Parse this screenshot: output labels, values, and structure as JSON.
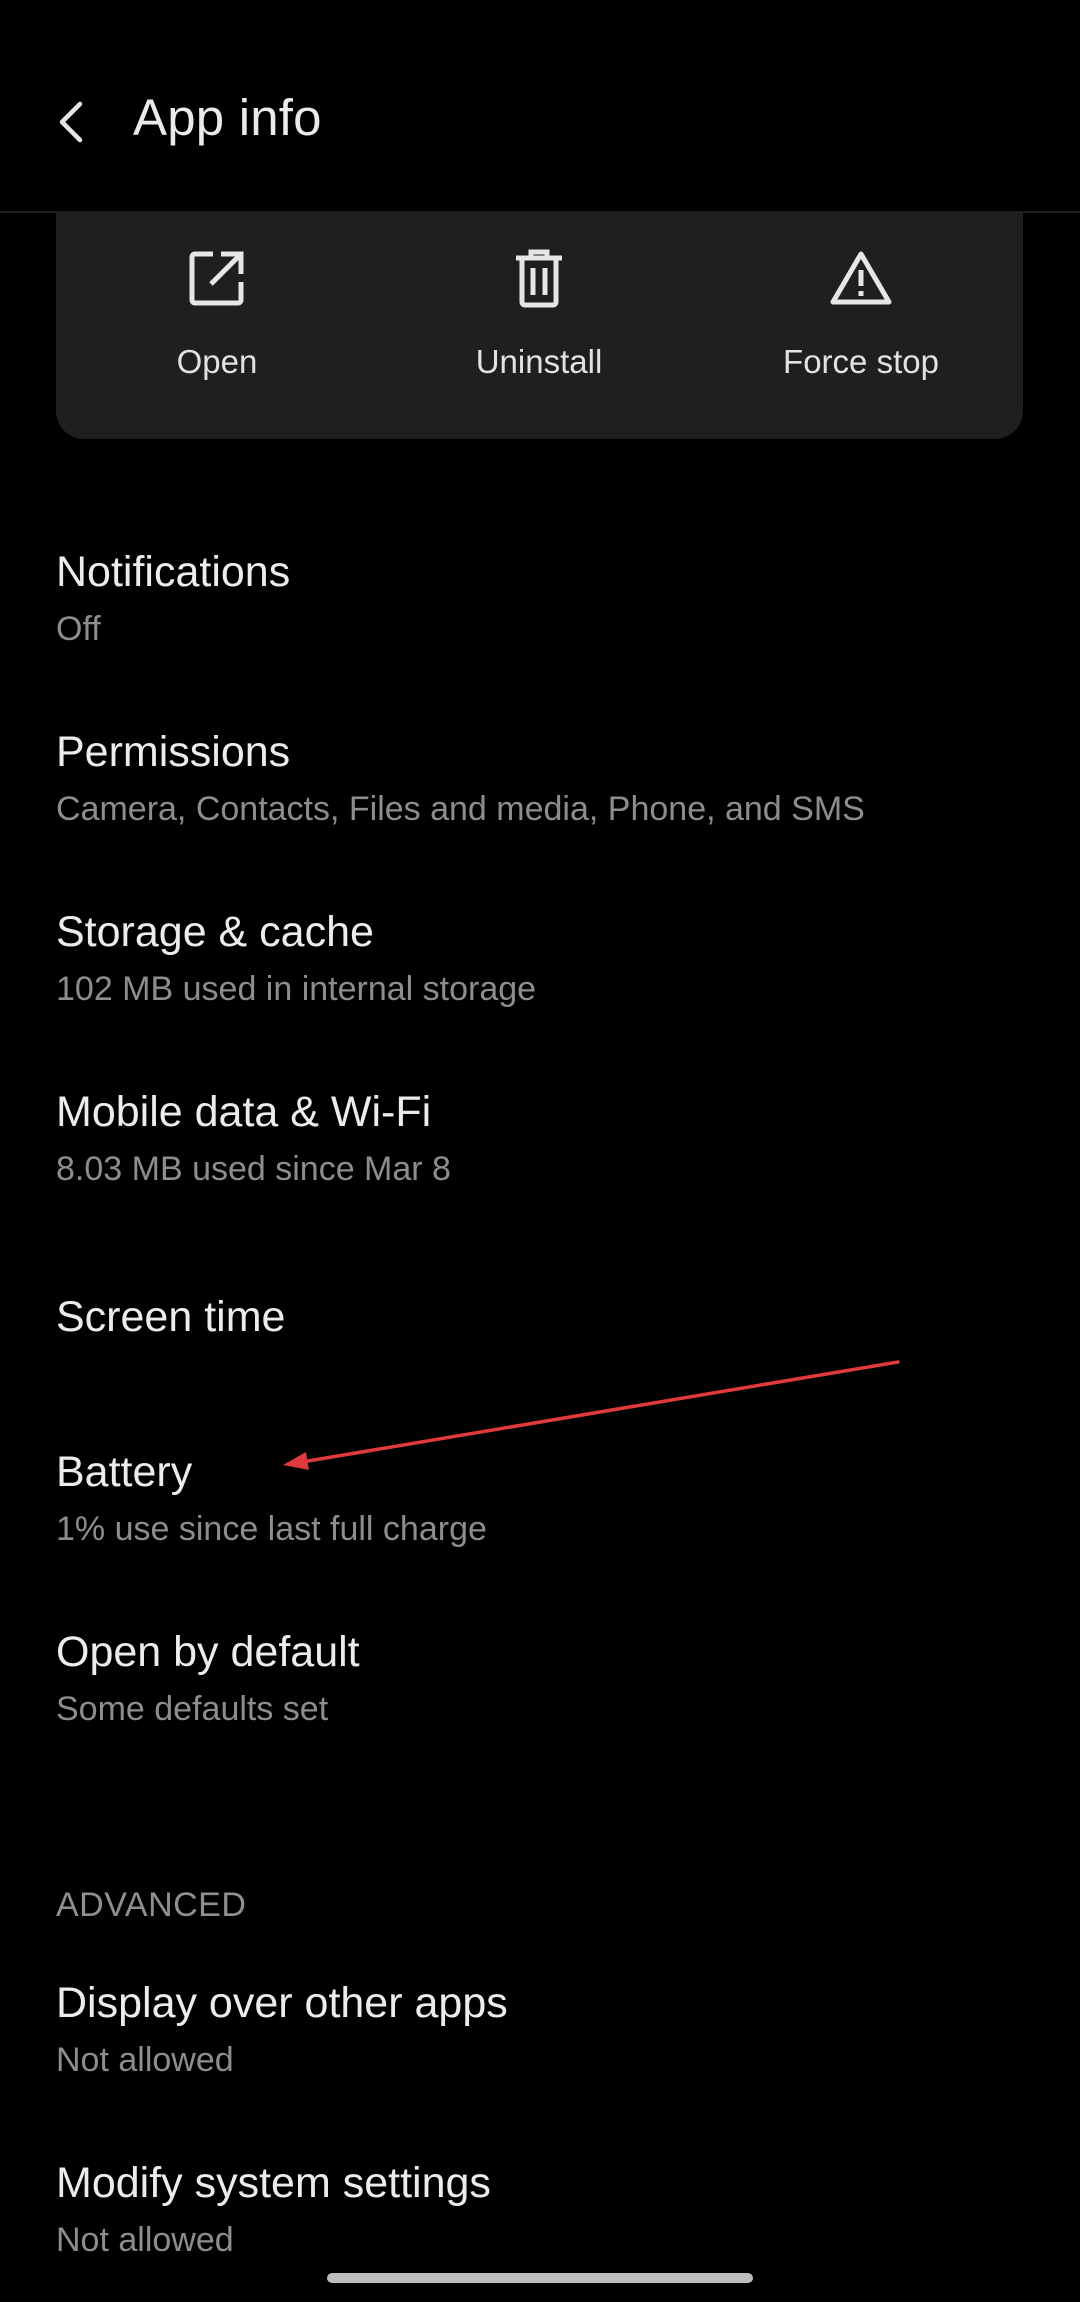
{
  "header": {
    "title": "App info",
    "back_icon": "chevron-left-icon"
  },
  "actions": {
    "open_label": "Open",
    "open_icon": "open-external-icon",
    "uninstall_label": "Uninstall",
    "uninstall_icon": "trash-icon",
    "force_stop_label": "Force stop",
    "force_stop_icon": "warning-triangle-icon"
  },
  "settings": {
    "notifications": {
      "title": "Notifications",
      "subtitle": "Off"
    },
    "permissions": {
      "title": "Permissions",
      "subtitle": "Camera, Contacts, Files and media, Phone, and SMS"
    },
    "storage": {
      "title": "Storage & cache",
      "subtitle": "102 MB used in internal storage"
    },
    "data": {
      "title": "Mobile data & Wi-Fi",
      "subtitle": "8.03 MB used since Mar 8"
    },
    "screen_time": {
      "title": "Screen time"
    },
    "battery": {
      "title": "Battery",
      "subtitle": "1% use since last full charge"
    },
    "open_by_default": {
      "title": "Open by default",
      "subtitle": "Some defaults set"
    }
  },
  "advanced": {
    "header": "ADVANCED",
    "display_over": {
      "title": "Display over other apps",
      "subtitle": "Not allowed"
    },
    "modify_system": {
      "title": "Modify system settings",
      "subtitle": "Not allowed"
    }
  },
  "colors": {
    "background": "#000000",
    "card": "#1d1f21",
    "primary_text": "#ececec",
    "secondary_text": "#8d8d8d",
    "annotation_arrow": "#e0393e"
  }
}
